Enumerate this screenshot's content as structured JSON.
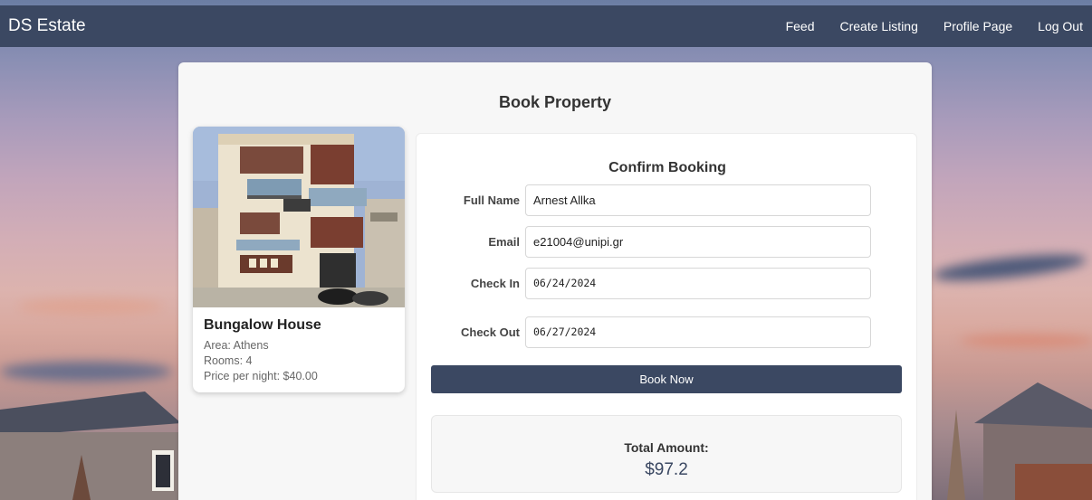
{
  "navbar": {
    "brand": "DS Estate",
    "links": [
      "Feed",
      "Create Listing",
      "Profile Page",
      "Log Out"
    ]
  },
  "page": {
    "title": "Book Property"
  },
  "property": {
    "name": "Bungalow House",
    "area": "Area: Athens",
    "rooms": "Rooms: 4",
    "price": "Price per night: $40.00"
  },
  "form": {
    "title": "Confirm Booking",
    "full_name": {
      "label": "Full Name",
      "value": "Arnest Allka"
    },
    "email": {
      "label": "Email",
      "value": "e21004@unipi.gr"
    },
    "check_in": {
      "label": "Check In",
      "value": "06/24/2024"
    },
    "check_out": {
      "label": "Check Out",
      "value": "06/27/2024"
    },
    "submit_label": "Book Now"
  },
  "total": {
    "label": "Total Amount:",
    "value": "$97.2"
  },
  "colors": {
    "navbar": "#3b4862",
    "accent": "#3b4862",
    "card": "#f7f7f7"
  }
}
